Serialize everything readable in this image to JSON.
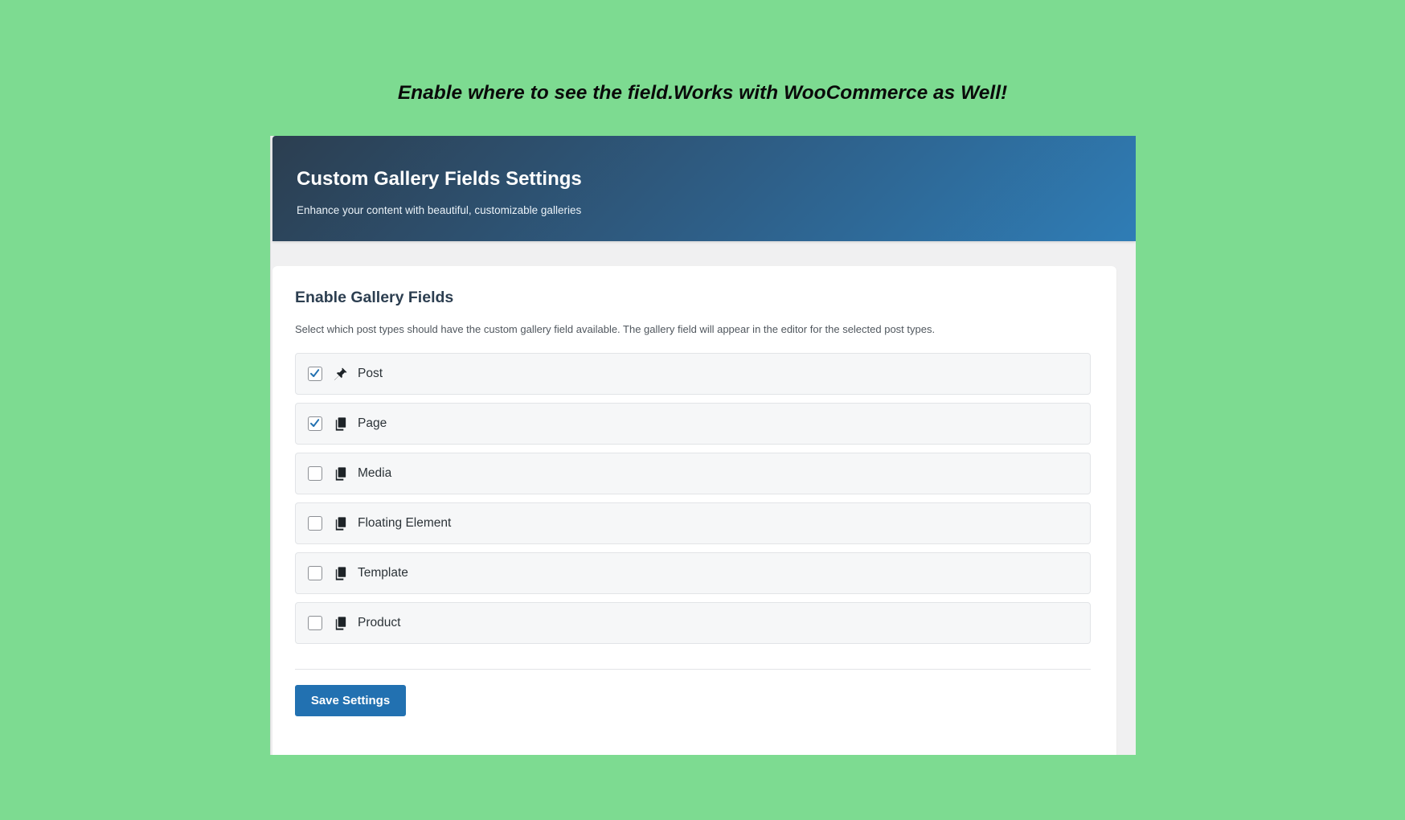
{
  "tagline": "Enable where to see the field.Works with WooCommerce as Well!",
  "header": {
    "title": "Custom Gallery Fields Settings",
    "subtitle": "Enhance your content with beautiful, customizable galleries"
  },
  "card": {
    "title": "Enable Gallery Fields",
    "description": "Select which post types should have the custom gallery field available. The gallery field will appear in the editor for the selected post types."
  },
  "options": [
    {
      "label": "Post",
      "checked": true,
      "icon": "pin-icon"
    },
    {
      "label": "Page",
      "checked": true,
      "icon": "pages-icon"
    },
    {
      "label": "Media",
      "checked": false,
      "icon": "pages-icon"
    },
    {
      "label": "Floating Element",
      "checked": false,
      "icon": "pages-icon"
    },
    {
      "label": "Template",
      "checked": false,
      "icon": "pages-icon"
    },
    {
      "label": "Product",
      "checked": false,
      "icon": "pages-icon"
    }
  ],
  "save_button": {
    "label": "Save Settings"
  },
  "colors": {
    "background": "#7ddb91",
    "header_gradient_start": "#2c3e50",
    "header_gradient_end": "#2f7db6",
    "button": "#2271b1",
    "checkmark": "#2271b1"
  }
}
